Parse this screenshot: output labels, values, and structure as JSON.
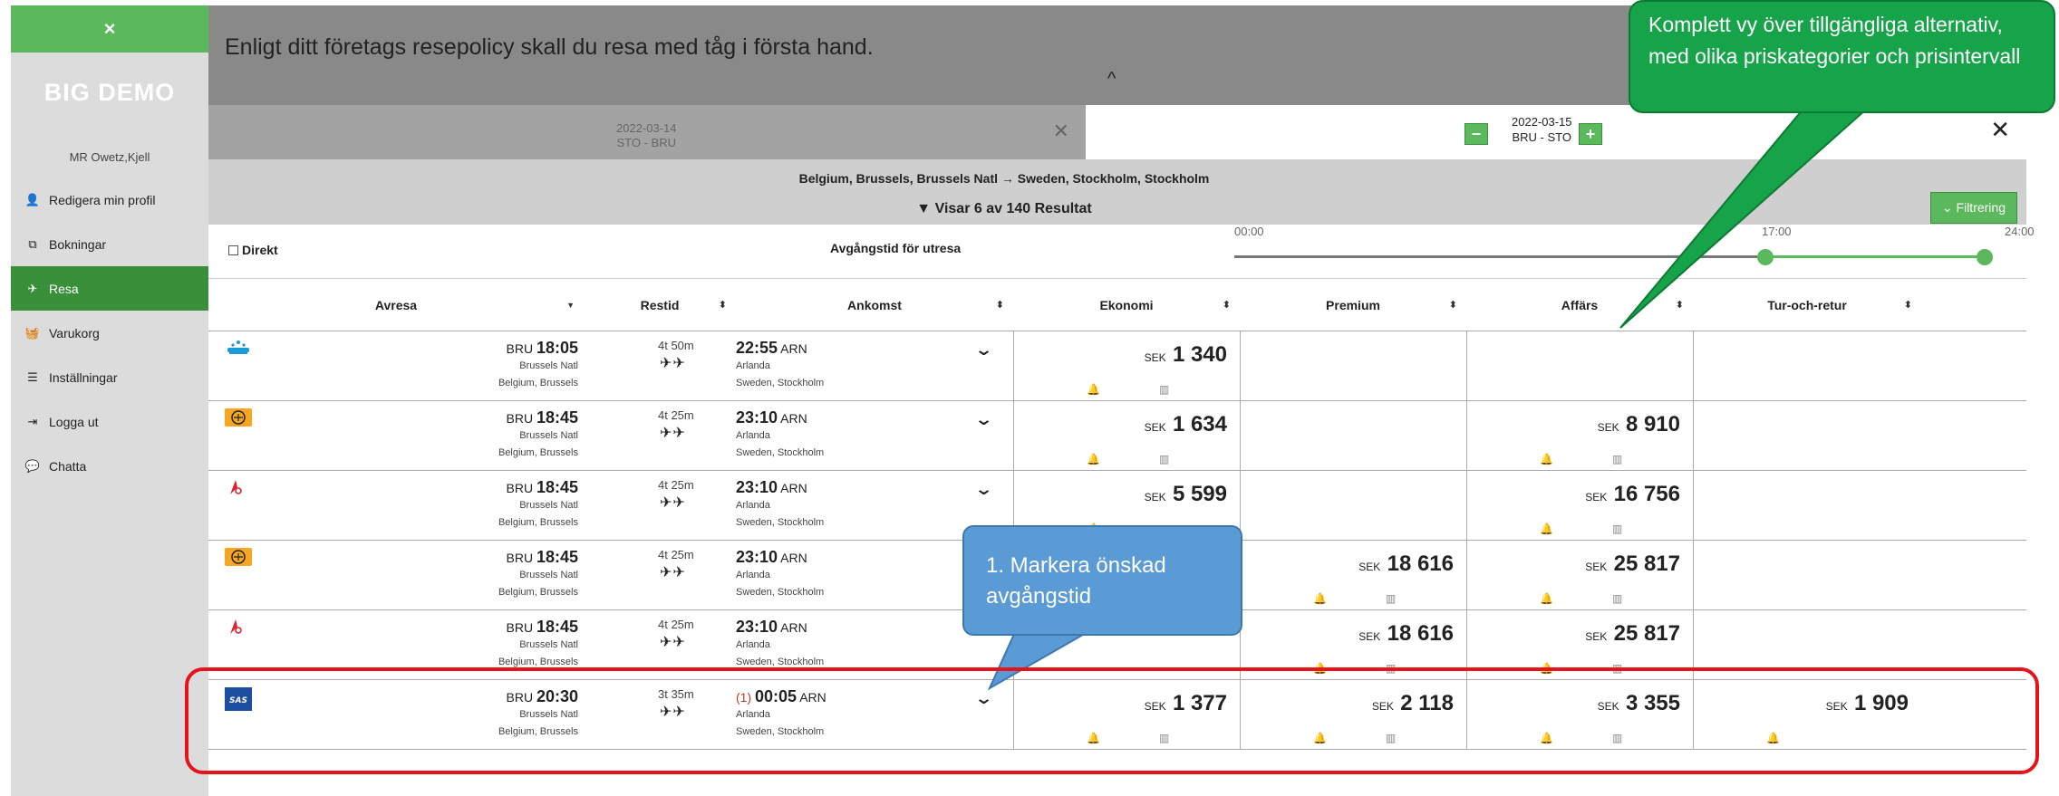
{
  "sidebar": {
    "close": "×",
    "brand": "BIG DEMO",
    "user": "MR Owetz,Kjell",
    "items": [
      {
        "label": "Redigera min profil",
        "icon": "user-icon",
        "glyph": "👤"
      },
      {
        "label": "Bokningar",
        "icon": "copy-icon",
        "glyph": "⧉"
      },
      {
        "label": "Resa",
        "icon": "plane-icon",
        "glyph": "✈"
      },
      {
        "label": "Varukorg",
        "icon": "basket-icon",
        "glyph": "🧺"
      },
      {
        "label": "Inställningar",
        "icon": "list-icon",
        "glyph": "☰"
      },
      {
        "label": "Logga ut",
        "icon": "logout-icon",
        "glyph": "⇥"
      },
      {
        "label": "Chatta",
        "icon": "chat-icon",
        "glyph": "💬"
      }
    ]
  },
  "policy": {
    "text": "Enligt ditt företags resepolicy skall du resa med tåg i första hand.",
    "caret": "^"
  },
  "tabs": {
    "outbound": {
      "date": "2022-03-14",
      "route": "STO - BRU",
      "close": "✕"
    },
    "inbound": {
      "date": "2022-03-15",
      "route": "BRU - STO",
      "minus": "−",
      "plus": "+",
      "close": "✕"
    }
  },
  "route": {
    "line": "Belgium, Brussels, Brussels Natl → Sweden, Stockholm, Stockholm",
    "results": "Visar 6 av 140 Resultat",
    "filter_button": "Filtrering"
  },
  "timebar": {
    "direct_label": "Direkt",
    "label": "Avgångstid för utresa",
    "ticks": [
      "00:00",
      "17:00",
      "24:00"
    ],
    "range_start_fraction": 0.708,
    "range_end_fraction": 1.0
  },
  "columns": {
    "avresa": "Avresa",
    "restid": "Restid",
    "ankomst": "Ankomst",
    "ekonomi": "Ekonomi",
    "premium": "Premium",
    "affars": "Affärs",
    "turretur": "Tur-och-retur"
  },
  "currency": "SEK",
  "flights": [
    {
      "airline": "KLM",
      "dep_code": "BRU",
      "dep_time": "18:05",
      "dep_airport": "Brussels Natl",
      "dep_city": "Belgium, Brussels",
      "duration": "4t 50m",
      "arr_prefix": "",
      "arr_time": "22:55",
      "arr_code": "ARN",
      "arr_airport": "Arlanda",
      "arr_city": "Sweden, Stockholm",
      "prices": {
        "ekonomi": "1 340",
        "premium": "",
        "affars": "",
        "turretur": ""
      }
    },
    {
      "airline": "Lufthansa",
      "dep_code": "BRU",
      "dep_time": "18:45",
      "dep_airport": "Brussels Natl",
      "dep_city": "Belgium, Brussels",
      "duration": "4t 25m",
      "arr_prefix": "",
      "arr_time": "23:10",
      "arr_code": "ARN",
      "arr_airport": "Arlanda",
      "arr_city": "Sweden, Stockholm",
      "prices": {
        "ekonomi": "1 634",
        "premium": "",
        "affars": "8 910",
        "turretur": ""
      }
    },
    {
      "airline": "Brussels Airlines",
      "dep_code": "BRU",
      "dep_time": "18:45",
      "dep_airport": "Brussels Natl",
      "dep_city": "Belgium, Brussels",
      "duration": "4t 25m",
      "arr_prefix": "",
      "arr_time": "23:10",
      "arr_code": "ARN",
      "arr_airport": "Arlanda",
      "arr_city": "Sweden, Stockholm",
      "prices": {
        "ekonomi": "5 599",
        "premium": "",
        "affars": "16 756",
        "turretur": ""
      }
    },
    {
      "airline": "Lufthansa",
      "dep_code": "BRU",
      "dep_time": "18:45",
      "dep_airport": "Brussels Natl",
      "dep_city": "Belgium, Brussels",
      "duration": "4t 25m",
      "arr_prefix": "",
      "arr_time": "23:10",
      "arr_code": "ARN",
      "arr_airport": "Arlanda",
      "arr_city": "Sweden, Stockholm",
      "prices": {
        "ekonomi": "",
        "premium": "18 616",
        "affars": "25 817",
        "turretur": ""
      }
    },
    {
      "airline": "Brussels Airlines",
      "dep_code": "BRU",
      "dep_time": "18:45",
      "dep_airport": "Brussels Natl",
      "dep_city": "Belgium, Brussels",
      "duration": "4t 25m",
      "arr_prefix": "",
      "arr_time": "23:10",
      "arr_code": "ARN",
      "arr_airport": "Arlanda",
      "arr_city": "Sweden, Stockholm",
      "prices": {
        "ekonomi": "",
        "premium": "18 616",
        "affars": "25 817",
        "turretur": ""
      }
    },
    {
      "airline": "SAS",
      "dep_code": "BRU",
      "dep_time": "20:30",
      "dep_airport": "Brussels Natl",
      "dep_city": "Belgium, Brussels",
      "duration": "3t 35m",
      "arr_prefix": "(1)",
      "arr_time": "00:05",
      "arr_code": "ARN",
      "arr_airport": "Arlanda",
      "arr_city": "Sweden, Stockholm",
      "prices": {
        "ekonomi": "1 377",
        "premium": "2 118",
        "affars": "3 355",
        "turretur": "1 909"
      }
    }
  ],
  "callouts": {
    "green": "Komplett vy över tillgängliga alternativ, med olika priskategorier och prisintervall",
    "blue": "1. Markera önskad avgångstid"
  },
  "colors": {
    "accent_green": "#5cb85c",
    "active_green": "#3a8f3a",
    "callout_green": "#16a34a",
    "callout_blue": "#5b9bd5",
    "highlight_red": "#e8121a",
    "delay_red": "#c0392b"
  }
}
